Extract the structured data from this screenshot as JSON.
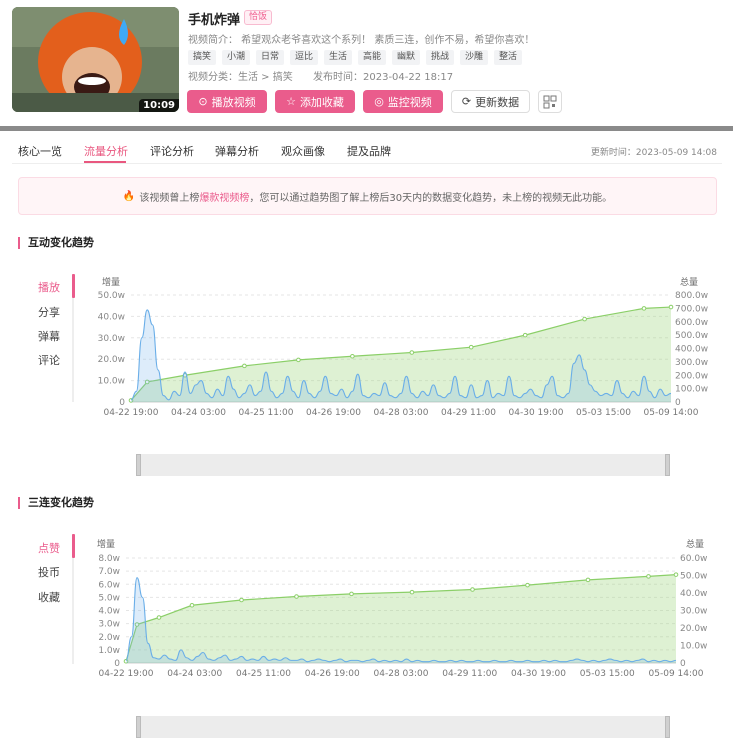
{
  "video": {
    "duration": "10:09",
    "title": "手机炸弹",
    "badge": "恰饭",
    "intro": "视频简介：  希望观众老爷喜欢这个系列！   素质三连，创作不易，希望你喜欢！",
    "tags": [
      "搞笑",
      "小潮",
      "日常",
      "逗比",
      "生活",
      "高能",
      "幽默",
      "挑战",
      "沙雕",
      "整活"
    ],
    "category": "视频分类：生活 > 搞笑",
    "publish": "发布时间：2023-04-22 18:17"
  },
  "buttons": {
    "play": "播放视频",
    "collect": "添加收藏",
    "monitor": "监控视频",
    "refresh": "更新数据"
  },
  "tabs": [
    "核心一览",
    "流量分析",
    "评论分析",
    "弹幕分析",
    "观众画像",
    "提及品牌"
  ],
  "update_time": "更新时间：2023-05-09 14:08",
  "notice": {
    "pre": "该视频曾上榜",
    "link": "爆款视频榜",
    "post": "，您可以通过趋势图了解上榜后30天内的数据变化趋势，未上榜的视频无此功能。"
  },
  "section1": {
    "title": "互动变化趋势",
    "side": [
      "播放",
      "分享",
      "弹幕",
      "评论"
    ],
    "left_axis_title": "增量",
    "right_axis_title": "总量"
  },
  "section2": {
    "title": "三连变化趋势",
    "side": [
      "点赞",
      "投币",
      "收藏"
    ],
    "left_axis_title": "增量",
    "right_axis_title": "总量"
  },
  "chart_data": [
    {
      "type": "area",
      "title": "互动变化趋势",
      "series_shown": "播放",
      "x_ticks": [
        "04-22 19:00",
        "04-24 03:00",
        "04-25 11:00",
        "04-26 19:00",
        "04-28 03:00",
        "04-29 11:00",
        "04-30 19:00",
        "05-03 15:00",
        "05-09 14:00"
      ],
      "left_ticks": [
        "0",
        "10.0w",
        "20.0w",
        "30.0w",
        "40.0w",
        "50.0w"
      ],
      "right_ticks": [
        "0",
        "100.0w",
        "200.0w",
        "300.0w",
        "400.0w",
        "500.0w",
        "600.0w",
        "700.0w",
        "800.0w"
      ],
      "left_range": [
        0,
        50
      ],
      "right_range": [
        0,
        800
      ],
      "total": [
        [
          0,
          12
        ],
        [
          3,
          150
        ],
        [
          10,
          200
        ],
        [
          21,
          270
        ],
        [
          31,
          315
        ],
        [
          41,
          342
        ],
        [
          52,
          370
        ],
        [
          63,
          410
        ],
        [
          73,
          500
        ],
        [
          84,
          620
        ],
        [
          95,
          700
        ],
        [
          100,
          710
        ]
      ],
      "increment": [
        [
          0,
          1
        ],
        [
          1,
          5
        ],
        [
          2,
          30
        ],
        [
          3,
          43
        ],
        [
          4,
          36
        ],
        [
          5,
          15
        ],
        [
          6,
          3
        ],
        [
          7,
          1
        ],
        [
          8,
          5
        ],
        [
          9,
          3
        ],
        [
          10,
          14
        ],
        [
          11,
          4
        ],
        [
          12,
          8
        ],
        [
          13,
          10
        ],
        [
          14,
          4
        ],
        [
          15,
          2
        ],
        [
          16,
          6
        ],
        [
          17,
          3
        ],
        [
          18,
          12
        ],
        [
          19,
          6
        ],
        [
          20,
          2
        ],
        [
          21,
          4
        ],
        [
          22,
          8
        ],
        [
          23,
          3
        ],
        [
          24,
          5
        ],
        [
          25,
          14
        ],
        [
          26,
          5
        ],
        [
          27,
          2
        ],
        [
          28,
          4
        ],
        [
          29,
          12
        ],
        [
          30,
          5
        ],
        [
          31,
          2
        ],
        [
          32,
          10
        ],
        [
          33,
          4
        ],
        [
          34,
          2
        ],
        [
          35,
          5
        ],
        [
          36,
          12
        ],
        [
          37,
          4
        ],
        [
          38,
          3
        ],
        [
          39,
          6
        ],
        [
          40,
          2
        ],
        [
          41,
          5
        ],
        [
          42,
          13
        ],
        [
          43,
          3
        ],
        [
          44,
          2
        ],
        [
          45,
          4
        ],
        [
          46,
          3
        ],
        [
          47,
          9
        ],
        [
          48,
          3
        ],
        [
          49,
          2
        ],
        [
          50,
          4
        ],
        [
          51,
          12
        ],
        [
          52,
          4
        ],
        [
          53,
          2
        ],
        [
          54,
          5
        ],
        [
          55,
          3
        ],
        [
          56,
          8
        ],
        [
          57,
          3
        ],
        [
          58,
          2
        ],
        [
          59,
          4
        ],
        [
          60,
          12
        ],
        [
          61,
          3
        ],
        [
          62,
          2
        ],
        [
          63,
          8
        ],
        [
          64,
          2
        ],
        [
          65,
          3
        ],
        [
          66,
          10
        ],
        [
          67,
          2
        ],
        [
          68,
          4
        ],
        [
          69,
          3
        ],
        [
          70,
          12
        ],
        [
          71,
          3
        ],
        [
          72,
          2
        ],
        [
          73,
          4
        ],
        [
          74,
          6
        ],
        [
          75,
          3
        ],
        [
          76,
          2
        ],
        [
          77,
          8
        ],
        [
          78,
          12
        ],
        [
          79,
          3
        ],
        [
          80,
          2
        ],
        [
          81,
          4
        ],
        [
          82,
          18
        ],
        [
          83,
          22
        ],
        [
          84,
          15
        ],
        [
          85,
          8
        ],
        [
          86,
          5
        ],
        [
          87,
          3
        ],
        [
          88,
          4
        ],
        [
          89,
          3
        ],
        [
          90,
          10
        ],
        [
          91,
          4
        ],
        [
          92,
          2
        ],
        [
          93,
          5
        ],
        [
          94,
          3
        ],
        [
          95,
          12
        ],
        [
          96,
          5
        ],
        [
          97,
          2
        ],
        [
          98,
          6
        ],
        [
          99,
          3
        ],
        [
          100,
          4
        ]
      ]
    },
    {
      "type": "area",
      "title": "三连变化趋势",
      "series_shown": "点赞",
      "x_ticks": [
        "04-22 19:00",
        "04-24 03:00",
        "04-25 11:00",
        "04-26 19:00",
        "04-28 03:00",
        "04-29 11:00",
        "04-30 19:00",
        "05-03 15:00",
        "05-09 14:00"
      ],
      "left_ticks": [
        "0",
        "1.0w",
        "2.0w",
        "3.0w",
        "4.0w",
        "5.0w",
        "6.0w",
        "7.0w",
        "8.0w"
      ],
      "right_ticks": [
        "0",
        "10.0w",
        "20.0w",
        "30.0w",
        "40.0w",
        "50.0w",
        "60.0w"
      ],
      "left_range": [
        0,
        8
      ],
      "right_range": [
        0,
        60
      ],
      "total": [
        [
          0,
          1
        ],
        [
          2,
          22
        ],
        [
          6,
          26
        ],
        [
          12,
          33
        ],
        [
          21,
          36
        ],
        [
          31,
          38
        ],
        [
          41,
          39.5
        ],
        [
          52,
          40.5
        ],
        [
          63,
          42
        ],
        [
          73,
          44.5
        ],
        [
          84,
          47.5
        ],
        [
          95,
          49.5
        ],
        [
          100,
          50.5
        ]
      ],
      "increment": [
        [
          0,
          0.2
        ],
        [
          1,
          2
        ],
        [
          2,
          6.5
        ],
        [
          3,
          5
        ],
        [
          4,
          1.5
        ],
        [
          5,
          0.4
        ],
        [
          6,
          0.3
        ],
        [
          7,
          0.6
        ],
        [
          8,
          0.3
        ],
        [
          9,
          0.2
        ],
        [
          10,
          1.0
        ],
        [
          11,
          0.4
        ],
        [
          12,
          0.2
        ],
        [
          13,
          0.5
        ],
        [
          14,
          0.8
        ],
        [
          15,
          0.3
        ],
        [
          16,
          0.2
        ],
        [
          17,
          0.4
        ],
        [
          18,
          0.6
        ],
        [
          19,
          0.2
        ],
        [
          20,
          0.3
        ],
        [
          21,
          0.5
        ],
        [
          22,
          0.2
        ],
        [
          23,
          0.3
        ],
        [
          24,
          0.2
        ],
        [
          25,
          0.5
        ],
        [
          26,
          0.2
        ],
        [
          27,
          0.3
        ],
        [
          28,
          0.2
        ],
        [
          29,
          0.4
        ],
        [
          30,
          0.2
        ],
        [
          31,
          0.2
        ],
        [
          32,
          0.3
        ],
        [
          33,
          0.1
        ],
        [
          34,
          0.2
        ],
        [
          35,
          0.3
        ],
        [
          36,
          0.2
        ],
        [
          37,
          0.1
        ],
        [
          38,
          0.2
        ],
        [
          39,
          0.3
        ],
        [
          40,
          0.1
        ],
        [
          41,
          0.2
        ],
        [
          42,
          0.2
        ],
        [
          43,
          0.1
        ],
        [
          44,
          0.2
        ],
        [
          45,
          0.3
        ],
        [
          46,
          0.1
        ],
        [
          47,
          0.2
        ],
        [
          48,
          0.1
        ],
        [
          49,
          0.2
        ],
        [
          50,
          0.1
        ],
        [
          51,
          0.3
        ],
        [
          52,
          0.1
        ],
        [
          53,
          0.2
        ],
        [
          54,
          0.1
        ],
        [
          55,
          0.1
        ],
        [
          56,
          0.2
        ],
        [
          57,
          0.1
        ],
        [
          58,
          0.1
        ],
        [
          59,
          0.2
        ],
        [
          60,
          0.1
        ],
        [
          61,
          0.2
        ],
        [
          62,
          0.1
        ],
        [
          63,
          0.1
        ],
        [
          64,
          0.2
        ],
        [
          65,
          0.1
        ],
        [
          66,
          0.1
        ],
        [
          67,
          0.2
        ],
        [
          68,
          0.1
        ],
        [
          69,
          0.1
        ],
        [
          70,
          0.2
        ],
        [
          71,
          0.1
        ],
        [
          72,
          0.1
        ],
        [
          73,
          0.2
        ],
        [
          74,
          0.1
        ],
        [
          75,
          0.1
        ],
        [
          76,
          0.2
        ],
        [
          77,
          0.1
        ],
        [
          78,
          0.2
        ],
        [
          79,
          0.1
        ],
        [
          80,
          0.1
        ],
        [
          81,
          0.2
        ],
        [
          82,
          0.3
        ],
        [
          83,
          0.2
        ],
        [
          84,
          0.1
        ],
        [
          85,
          0.2
        ],
        [
          86,
          0.1
        ],
        [
          87,
          0.2
        ],
        [
          88,
          0.3
        ],
        [
          89,
          0.2
        ],
        [
          90,
          0.1
        ],
        [
          91,
          0.2
        ],
        [
          92,
          0.1
        ],
        [
          93,
          0.2
        ],
        [
          94,
          0.3
        ],
        [
          95,
          0.1
        ],
        [
          96,
          0.2
        ],
        [
          97,
          0.1
        ],
        [
          98,
          0.2
        ],
        [
          99,
          0.1
        ],
        [
          100,
          0.2
        ]
      ]
    }
  ]
}
